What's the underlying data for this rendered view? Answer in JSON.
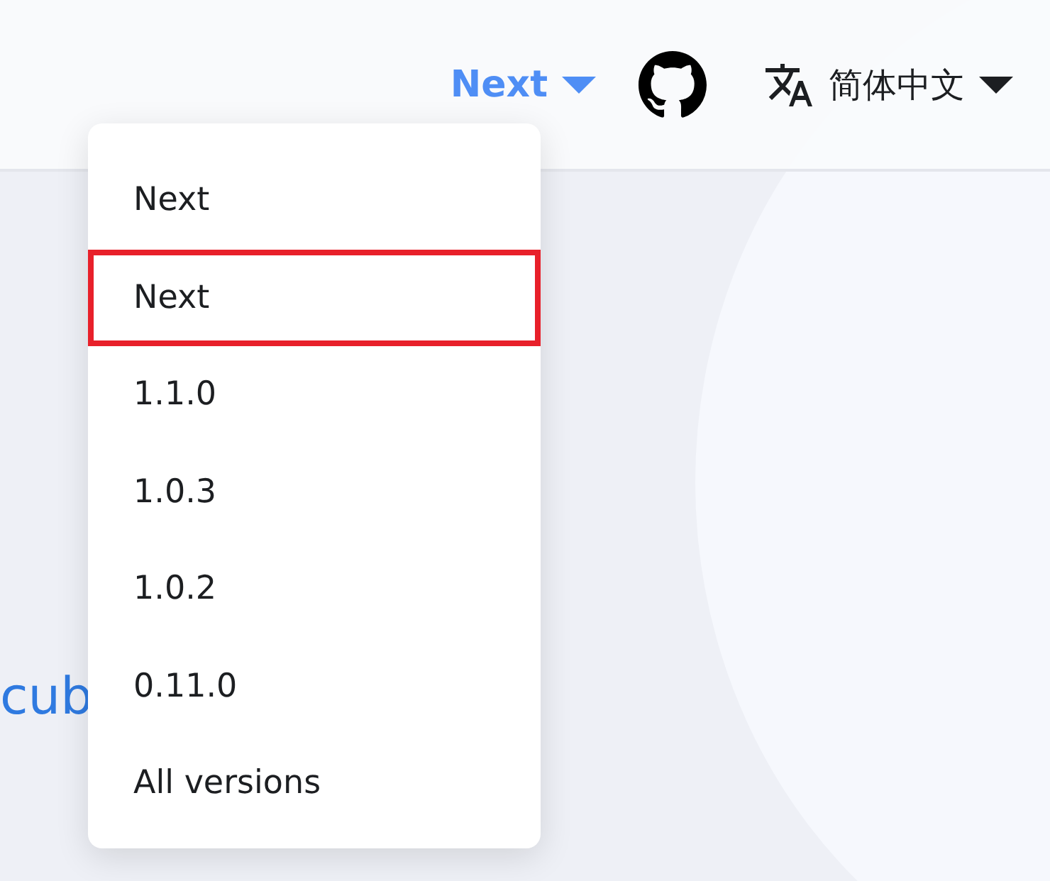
{
  "navbar": {
    "version_label": "Next",
    "language_label": "简体中文"
  },
  "content": {
    "heading_fragment": "cub"
  },
  "version_menu": {
    "open": true,
    "items": [
      {
        "label": "Next",
        "highlighted": false
      },
      {
        "label": "Next",
        "highlighted": true
      },
      {
        "label": "1.1.0",
        "highlighted": false
      },
      {
        "label": "1.0.3",
        "highlighted": false
      },
      {
        "label": "1.0.2",
        "highlighted": false
      },
      {
        "label": "0.11.0",
        "highlighted": false
      },
      {
        "label": "All versions",
        "highlighted": false
      }
    ]
  }
}
